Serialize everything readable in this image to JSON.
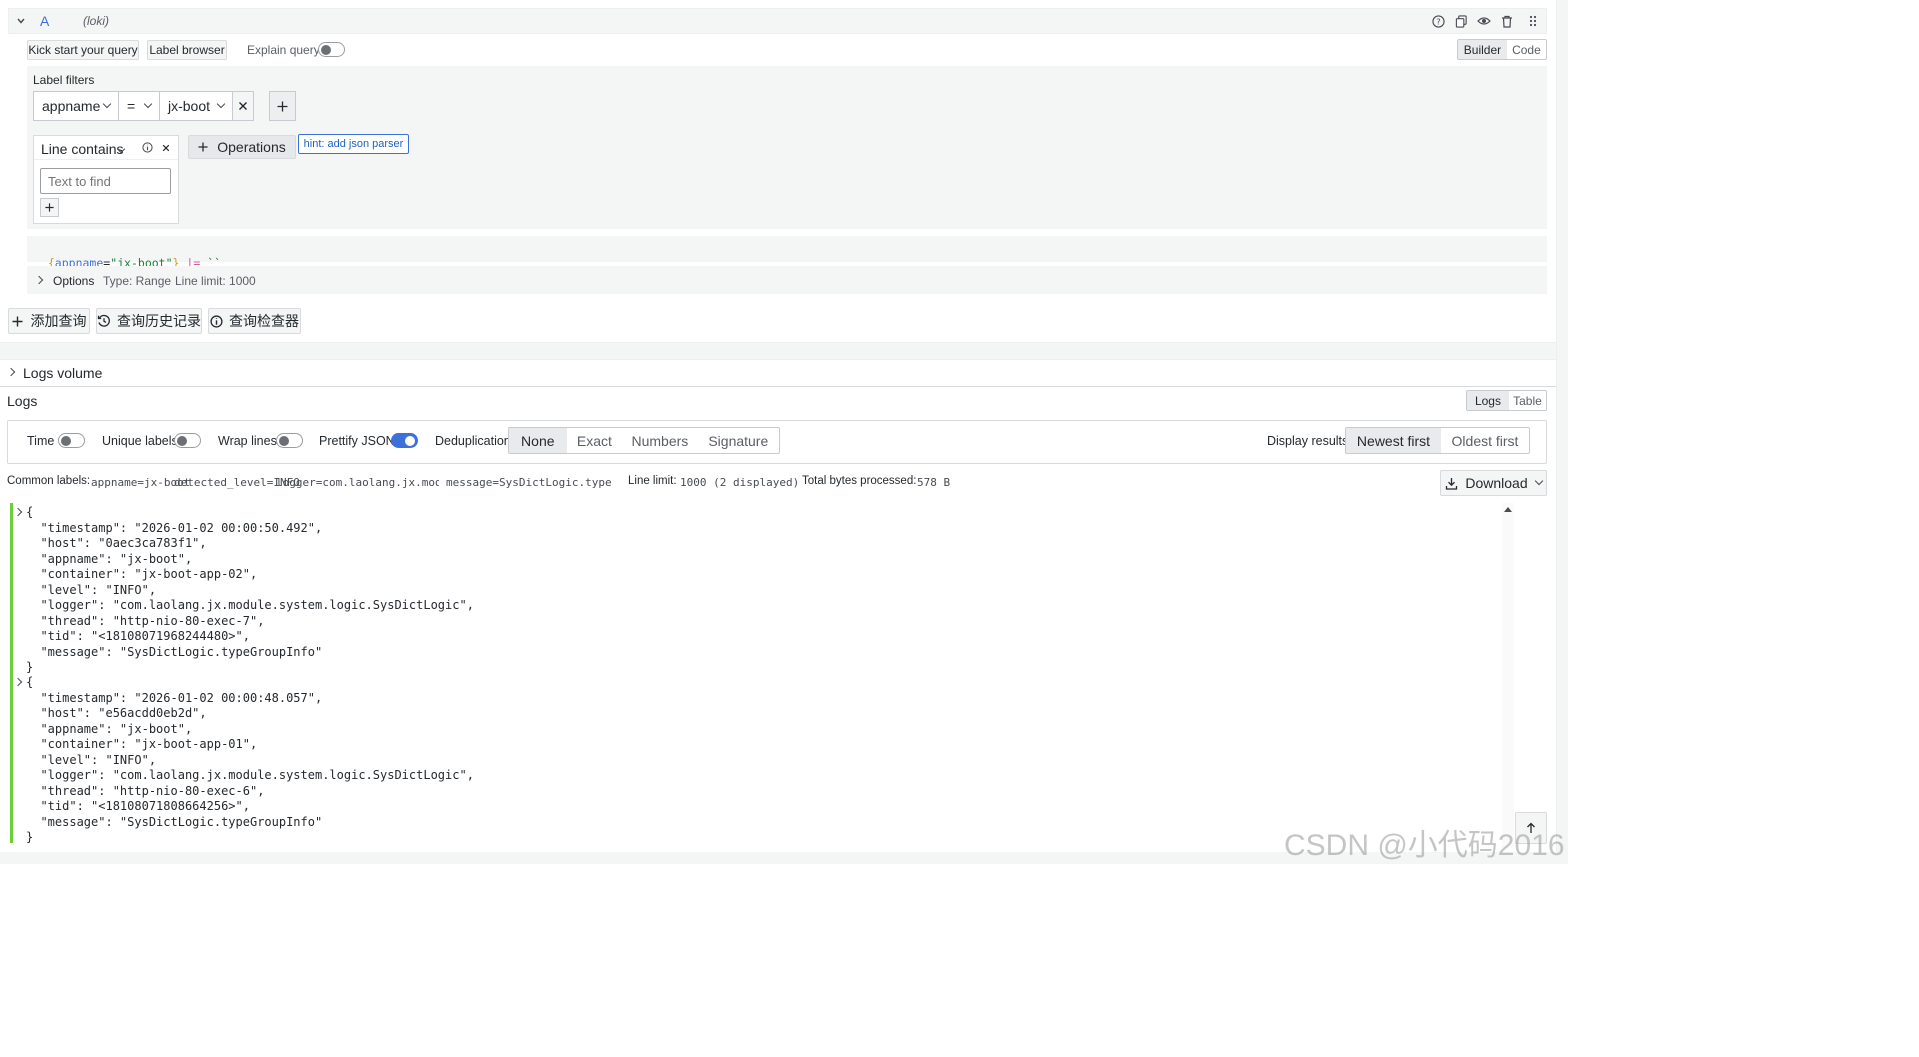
{
  "query_row": {
    "letter": "A",
    "datasource": "(loki)",
    "icons": [
      "help-icon",
      "copy-icon",
      "eye-icon",
      "trash-icon",
      "drag-icon"
    ]
  },
  "toolbar": {
    "kick_start": "Kick start your query",
    "label_browser": "Label browser",
    "explain_query": "Explain query",
    "builder": "Builder",
    "code": "Code"
  },
  "label_filters": {
    "title": "Label filters",
    "label": "appname",
    "operator": "=",
    "value": "jx-boot"
  },
  "operation": {
    "name": "Line contains",
    "placeholder": "Text to find",
    "operations_button": "Operations",
    "hint": "hint: add json parser"
  },
  "query_text": {
    "open": "{",
    "label": "appname",
    "eq": "=",
    "value": "\"jx-boot\"",
    "close": "}",
    "pipe": "|=",
    "literal": "``"
  },
  "options": {
    "title": "Options",
    "type": "Type: Range",
    "line_limit": "Line limit: 1000"
  },
  "actions": {
    "add_query": "添加查询",
    "history": "查询历史记录",
    "inspector": "查询检查器"
  },
  "logs_volume": "Logs volume",
  "logs": {
    "title": "Logs",
    "view_logs": "Logs",
    "view_table": "Table",
    "time": "Time",
    "unique_labels": "Unique labels",
    "wrap_lines": "Wrap lines",
    "prettify_json": "Prettify JSON",
    "deduplication": "Deduplication",
    "dedup_options": [
      "None",
      "Exact",
      "Numbers",
      "Signature"
    ],
    "display_results": "Display results",
    "newest_first": "Newest first",
    "oldest_first": "Oldest first",
    "common_labels_title": "Common labels:",
    "common_labels": [
      "appname=jx-boot",
      "detected_level=INFO",
      "logger=com.laolang.jx.module.sy…",
      "message=SysDictLogic.typeGroupI…"
    ],
    "line_limit_title": "Line limit:",
    "line_limit_value": "1000 (2 displayed)",
    "bytes_title": "Total bytes processed:",
    "bytes_value": "578 B",
    "download": "Download"
  },
  "log_entries": [
    {
      "lines": [
        "{",
        "  \"timestamp\": \"2026-01-02 00:00:50.492\",",
        "  \"host\": \"0aec3ca783f1\",",
        "  \"appname\": \"jx-boot\",",
        "  \"container\": \"jx-boot-app-02\",",
        "  \"level\": \"INFO\",",
        "  \"logger\": \"com.laolang.jx.module.system.logic.SysDictLogic\",",
        "  \"thread\": \"http-nio-80-exec-7\",",
        "  \"tid\": \"<18108071968244480>\",",
        "  \"message\": \"SysDictLogic.typeGroupInfo\"",
        "}"
      ]
    },
    {
      "lines": [
        "{",
        "  \"timestamp\": \"2026-01-02 00:00:48.057\",",
        "  \"host\": \"e56acdd0eb2d\",",
        "  \"appname\": \"jx-boot\",",
        "  \"container\": \"jx-boot-app-01\",",
        "  \"level\": \"INFO\",",
        "  \"logger\": \"com.laolang.jx.module.system.logic.SysDictLogic\",",
        "  \"thread\": \"http-nio-80-exec-6\",",
        "  \"tid\": \"<18108071808664256>\",",
        "  \"message\": \"SysDictLogic.typeGroupInfo\"",
        "}"
      ]
    }
  ],
  "watermark": "CSDN @小代码2016",
  "colors": {
    "accent": "#3d71d9",
    "log_bar": "#6ccf3a",
    "query_label": "#3d71d9",
    "query_value": "#1a7f37",
    "query_pipe": "#d25aa0"
  }
}
